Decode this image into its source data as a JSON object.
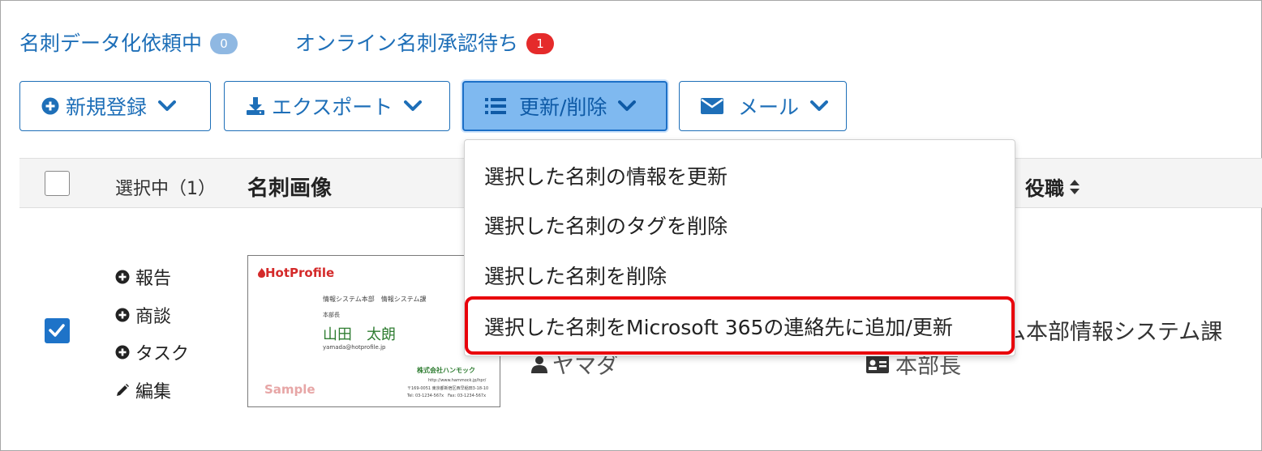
{
  "top_links": {
    "digitize_requests": {
      "label": "名刺データ化依頼中",
      "count": "0"
    },
    "online_pending": {
      "label": "オンライン名刺承認待ち",
      "count": "1"
    }
  },
  "toolbar": {
    "new_label": "新規登録",
    "export_label": "エクスポート",
    "update_delete_label": "更新/削除",
    "mail_label": "メール"
  },
  "table": {
    "selected_label": "選択中（1）",
    "col_image": "名刺画像",
    "col_title": "役職",
    "row": {
      "actions": [
        "報告",
        "商談",
        "タスク",
        "編集"
      ],
      "department_fragment": "ム本部情報システム課",
      "reading_fragment": "ヤマダ",
      "title_fragment": "本部長"
    }
  },
  "card": {
    "brand": "HotProfile",
    "dept": "情報システム本部　情報システム課",
    "role": "本部長",
    "name": "山田　太朗",
    "email": "yamada@hotprofile.jp",
    "company": "株式会社ハンモック",
    "url": "http://www.hammock.jp/hpr/",
    "address": "〒169-0051 東京都新宿区西早稲田3-18-10",
    "phone": "Tel: 03-1234-567x　Fax: 03-1234-567x",
    "watermark": "Sample"
  },
  "dropdown": {
    "items": [
      "選択した名刺の情報を更新",
      "選択した名刺のタグを削除",
      "選択した名刺を削除",
      "選択した名刺をMicrosoft 365の連絡先に追加/更新"
    ]
  },
  "colors": {
    "link_blue": "#1e6fb8",
    "active_button_bg": "#7fb9f0",
    "badge_red": "#e52b2b",
    "badge_gray": "#8fb8e2",
    "highlight_red": "#e8000b",
    "checkbox_blue": "#1e73c8"
  }
}
